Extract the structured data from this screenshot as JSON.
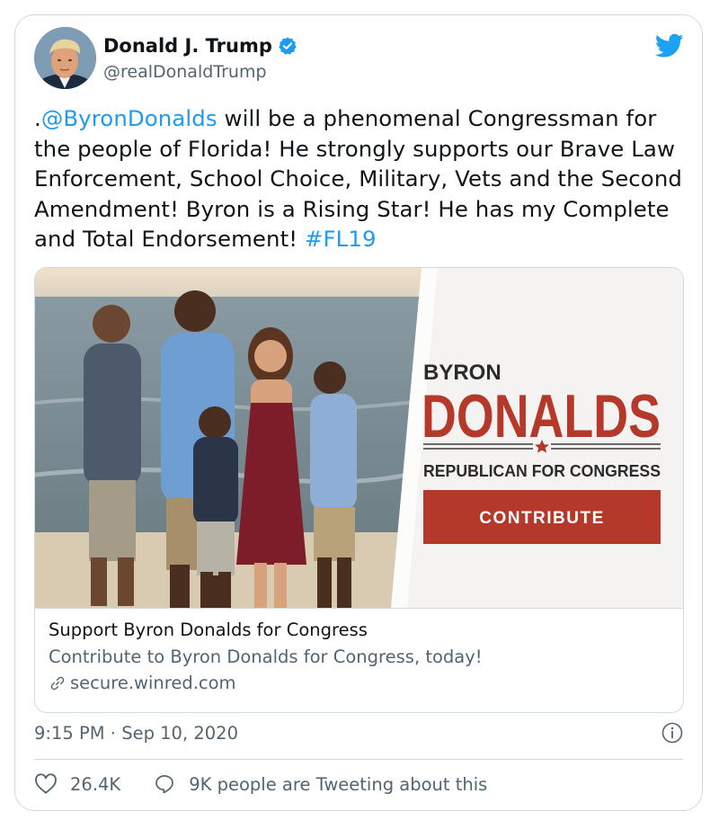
{
  "author": {
    "name": "Donald J. Trump",
    "handle": "@realDonaldTrump",
    "verified": true
  },
  "icons": {
    "brand": "twitter-bird-icon",
    "verified": "verified-badge-icon",
    "link": "link-icon",
    "info": "info-icon",
    "like": "heart-icon",
    "reply": "speech-bubble-icon"
  },
  "tweet": {
    "prefix": ".",
    "mention": "@ByronDonalds",
    "body": " will be a phenomenal Congressman for the people of Florida! He strongly supports our Brave Law Enforcement, School Choice, Military, Vets and the Second Amendment! Byron is a Rising Star! He has my Complete and Total Endorsement! ",
    "hashtag": "#FL19"
  },
  "card": {
    "banner": {
      "first_name": "BYRON",
      "last_name": "DONALDS",
      "tagline": "REPUBLICAN FOR CONGRESS",
      "cta": "CONTRIBUTE"
    },
    "title": "Support Byron Donalds for Congress",
    "description": "Contribute to Byron Donalds for Congress, today!",
    "domain": "secure.winred.com"
  },
  "meta": {
    "time": "9:15 PM",
    "separator": " · ",
    "date": "Sep 10, 2020"
  },
  "actions": {
    "likes": "26.4K",
    "tweeting": "9K people are Tweeting about this"
  },
  "colors": {
    "link_blue": "#1d9bf0",
    "twitter_blue": "#1da1f2",
    "banner_red": "#b5392b",
    "text_gray": "#536471",
    "border": "#cfd9de"
  }
}
